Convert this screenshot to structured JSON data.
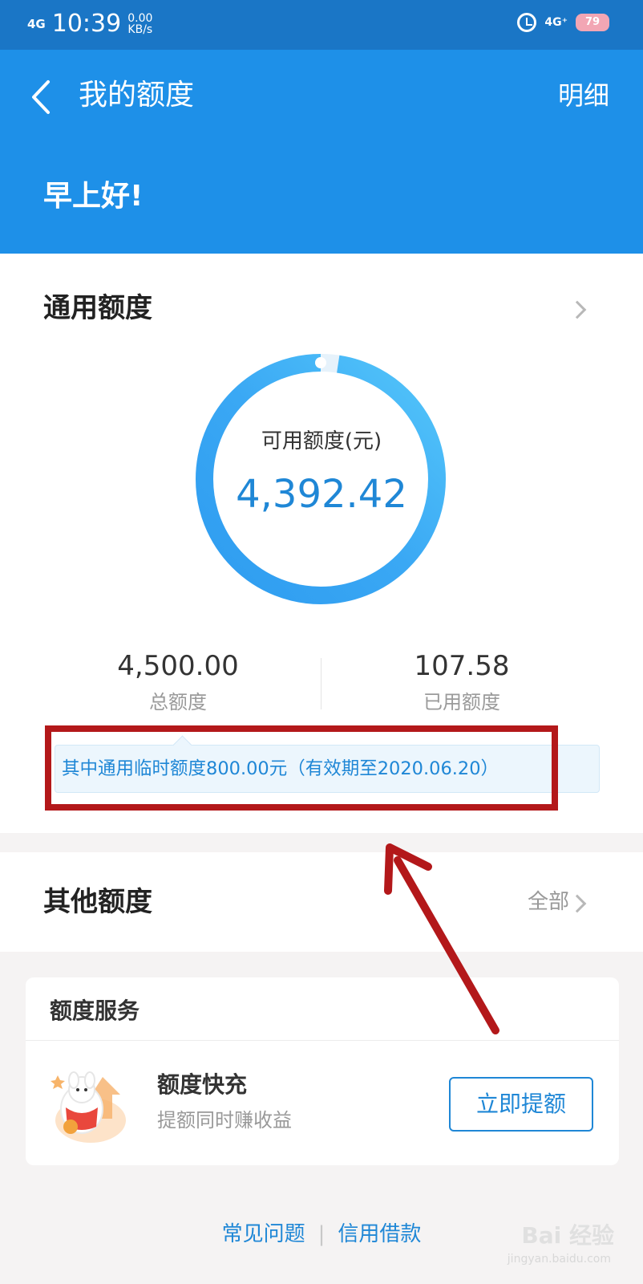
{
  "status_bar": {
    "signal": "4G",
    "time": "10:39",
    "speed_value": "0.00",
    "speed_unit": "KB/s",
    "network": "4G⁺",
    "battery": "79"
  },
  "header": {
    "title": "我的额度",
    "detail_label": "明细",
    "greeting": "早上好!"
  },
  "general_quota": {
    "title": "通用额度",
    "available_label": "可用额度(元)",
    "available_value": "4,392.42",
    "used_fraction": 0.024,
    "total_value": "4,500.00",
    "total_label": "总额度",
    "used_value": "107.58",
    "used_label": "已用额度",
    "temp_notice": "其中通用临时额度800.00元（有效期至2020.06.20）"
  },
  "other_quota": {
    "title": "其他额度",
    "all_label": "全部"
  },
  "quota_service": {
    "title": "额度服务",
    "item_name": "额度快充",
    "item_desc": "提额同时赚收益",
    "button_label": "立即提额"
  },
  "footer": {
    "faq_link": "常见问题",
    "separator": "|",
    "credit_link": "信用借款"
  },
  "watermark": {
    "text": "Bai 经验",
    "sub": "jingyan.baidu.com"
  },
  "colors": {
    "header_blue": "#1e90e8",
    "accent_blue": "#1f87d6",
    "annotation_red": "#b3181a"
  }
}
